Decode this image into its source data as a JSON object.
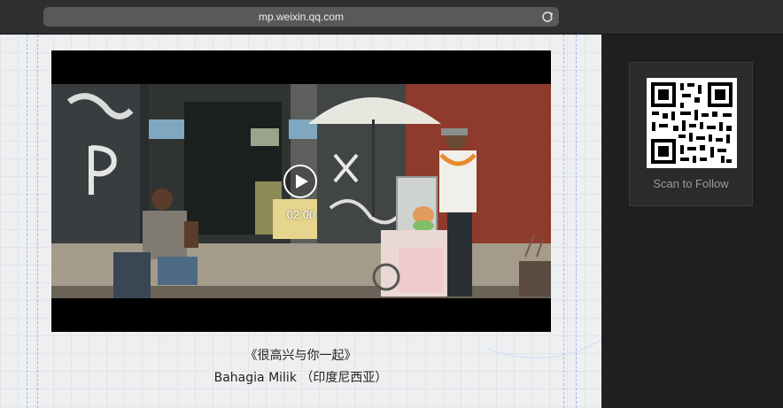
{
  "browser": {
    "url": "mp.weixin.qq.com"
  },
  "video": {
    "duration": "02:00"
  },
  "caption": {
    "title": "《很高兴与你一起》",
    "subtitle": "Bahagia Milik （印度尼西亚）"
  },
  "sidebar": {
    "qr_label": "Scan to Follow"
  },
  "colors": {
    "toolbar_bg": "#2f2f31",
    "urlbar_bg": "#59595b",
    "page_bg": "#eeeff1",
    "sidebar_bg": "#1f1f1f",
    "guide_line": "#9fb8f0"
  },
  "icons": {
    "reload": "reload-icon",
    "play": "play-icon"
  }
}
